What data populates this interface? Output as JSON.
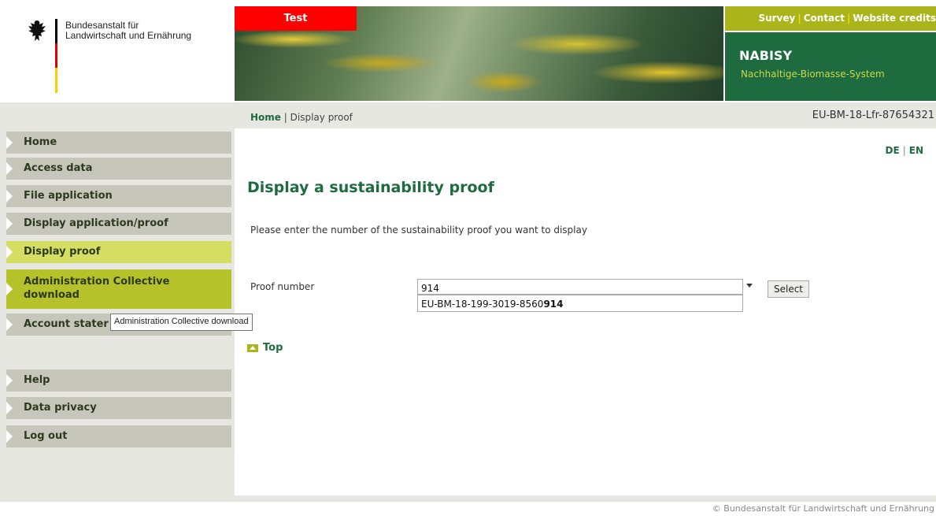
{
  "header": {
    "agency_line1": "Bundesanstalt für",
    "agency_line2": "Landwirtschaft und Ernährung",
    "test_label": "Test",
    "links": [
      "Survey",
      "Contact",
      "Website credits"
    ],
    "system_name": "NABISY",
    "system_subtitle": "Nachhaltige-Biomasse-System"
  },
  "breadcrumb": {
    "home": "Home",
    "separator": "|",
    "current": "Display proof"
  },
  "account_id": "EU-BM-18-Lfr-87654321",
  "language": {
    "de": "DE",
    "separator": "|",
    "en": "EN"
  },
  "sidebar": {
    "items": [
      {
        "label": "Home"
      },
      {
        "label": "Access data"
      },
      {
        "label": "File application"
      },
      {
        "label": "Display application/proof"
      },
      {
        "label": "Display proof"
      },
      {
        "label": "Administration Collective download"
      },
      {
        "label": "Account stater"
      },
      {
        "label": "Help"
      },
      {
        "label": "Data privacy"
      },
      {
        "label": "Log out"
      }
    ]
  },
  "main": {
    "title": "Display a sustainability proof",
    "instructions": "Please enter the number of the sustainability proof you want to display",
    "proof_label": "Proof number",
    "proof_value": "914",
    "suggestion_prefix": "EU-BM-18-199-3019-8560",
    "suggestion_match": "914",
    "select_label": "Select",
    "top_label": "Top"
  },
  "tooltip": "Administration Collective download",
  "footer": "© Bundesanstalt für Landwirtschaft und Ernährung",
  "colors": {
    "brand_green": "#1e6b3f",
    "lime": "#a9b51b",
    "active_nav": "#d4de63",
    "test_red": "#ff0000"
  }
}
